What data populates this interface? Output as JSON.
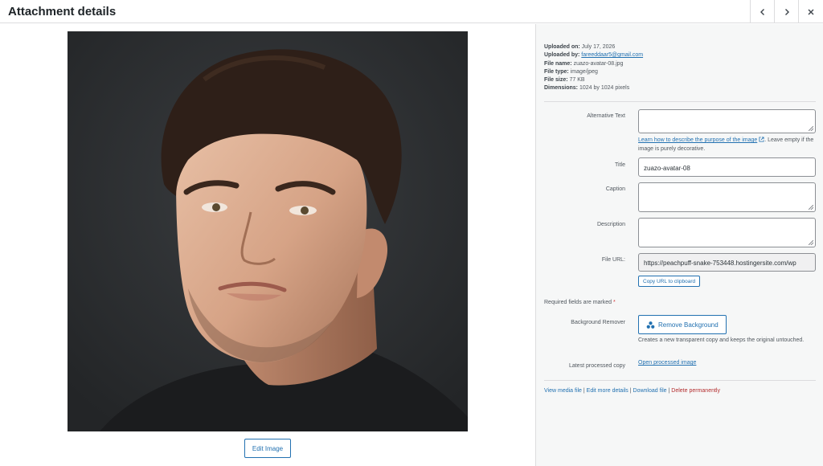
{
  "header": {
    "title": "Attachment details"
  },
  "left": {
    "edit_image_label": "Edit Image"
  },
  "meta": {
    "uploaded_on_label": "Uploaded on:",
    "uploaded_on": "July 17, 2026",
    "uploaded_by_label": "Uploaded by:",
    "uploaded_by": "fareeddaar5@gmail.com",
    "file_name_label": "File name:",
    "file_name": "zuazo-avatar-08.jpg",
    "file_type_label": "File type:",
    "file_type": "image/jpeg",
    "file_size_label": "File size:",
    "file_size": "77 KB",
    "dimensions_label": "Dimensions:",
    "dimensions": "1024 by 1024 pixels"
  },
  "fields": {
    "alt_label": "Alternative Text",
    "alt_value": "",
    "alt_help_link": "Learn how to describe the purpose of the image",
    "alt_help_text": ". Leave empty if the image is purely decorative.",
    "title_label": "Title",
    "title_value": "zuazo-avatar-08",
    "caption_label": "Caption",
    "caption_value": "",
    "description_label": "Description",
    "description_value": "",
    "file_url_label": "File URL:",
    "file_url_value": "https://peachpuff-snake-753448.hostingersite.com/wp",
    "copy_url_label": "Copy URL to clipboard"
  },
  "required_text": "Required fields are marked",
  "required_mark": "*",
  "background_remover": {
    "label": "Background Remover",
    "button_label": "Remove Background",
    "help": "Creates a new transparent copy and keeps the original untouched."
  },
  "latest_copy": {
    "label": "Latest processed copy",
    "link": "Open processed image"
  },
  "actions": {
    "view": "View media file",
    "edit_more": "Edit more details",
    "download": "Download file",
    "delete": "Delete permanently",
    "sep": " | "
  },
  "icons": {
    "prev": "chevron-left-icon",
    "next": "chevron-right-icon",
    "close": "close-icon",
    "external": "external-link-icon",
    "remove_bg": "dots-cluster-icon"
  },
  "colors": {
    "accent": "#2271b1",
    "danger": "#b32d2e",
    "required": "#d63638"
  }
}
